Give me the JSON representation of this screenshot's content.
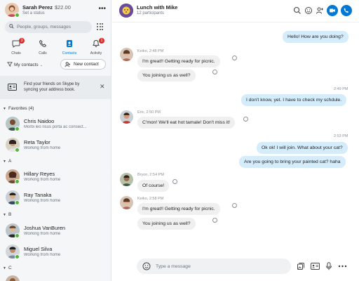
{
  "profile": {
    "name": "Sarah Perez",
    "credit": "$22.00",
    "status": "Set a status",
    "more": "•••"
  },
  "search": {
    "placeholder": "People, groups, messages"
  },
  "nav": [
    {
      "label": "Chats",
      "badge": "3",
      "icon": "chat-bubble-icon"
    },
    {
      "label": "Calls",
      "badge": "",
      "icon": "phone-icon"
    },
    {
      "label": "Contacts",
      "badge": "",
      "icon": "contacts-icon",
      "active": true
    },
    {
      "label": "Activity",
      "badge": "1",
      "icon": "bell-icon"
    }
  ],
  "contacts_filter": {
    "label": "My contacts",
    "new_contact": "New contact"
  },
  "sync_banner": {
    "text": "Find your friends on Skype by syncing your address book."
  },
  "sections": {
    "favorites": "Favorites (4)",
    "a": "A",
    "b": "B",
    "c": "C"
  },
  "contacts": [
    {
      "name": "Chris Naidoo",
      "status": "Morbi leo risus porta ac consect..."
    },
    {
      "name": "Reta Taylor",
      "status": "Working from home"
    },
    {
      "name": "Hillary Reyes",
      "status": "Working from home"
    },
    {
      "name": "Ray Tanaka",
      "status": "Working from home"
    },
    {
      "name": "Joshua VanBuren",
      "status": "Working from home"
    },
    {
      "name": "Miguel Silva",
      "status": "Working from home"
    }
  ],
  "chat": {
    "title": "Lunch with Mike",
    "participants": "12 participants",
    "messages": [
      {
        "from": "me",
        "text": "Hello! How are you doing?"
      },
      {
        "meta": "Keiko, 2:48 PM"
      },
      {
        "from": "Keiko",
        "text": "I'm great!! Getting ready for picnic."
      },
      {
        "from": "Keiko",
        "text": "You joining us as well?"
      },
      {
        "meta": "2:49 PM"
      },
      {
        "from": "me",
        "text": "I don't know, yet. I have to check my schdule."
      },
      {
        "meta": "Eric, 2:50 PM"
      },
      {
        "from": "Eric",
        "text": "C'mon! We'll eat hot tamale! Don't miss it!"
      },
      {
        "meta": "2:53 PM"
      },
      {
        "from": "me",
        "text": "Ok ok! I will join. What about your cat?"
      },
      {
        "from": "me",
        "text": "Are you going to bring your painted cat? haha"
      },
      {
        "meta": "Bryon, 2:54 PM"
      },
      {
        "from": "Bryon",
        "text": "Of course!"
      },
      {
        "meta": "Keiko, 2:58 PM"
      },
      {
        "from": "Keiko",
        "text": "I'm great!! Getting ready for picnic."
      },
      {
        "from": "Keiko",
        "text": "You joining us as well?"
      }
    ],
    "composer_placeholder": "Type a message"
  },
  "colors": {
    "accent": "#0078d4",
    "presence_online": "#53b33c",
    "badge": "#d92c2c",
    "bubble_out": "#d5ecfb",
    "bubble_in": "#f0f0f0"
  }
}
